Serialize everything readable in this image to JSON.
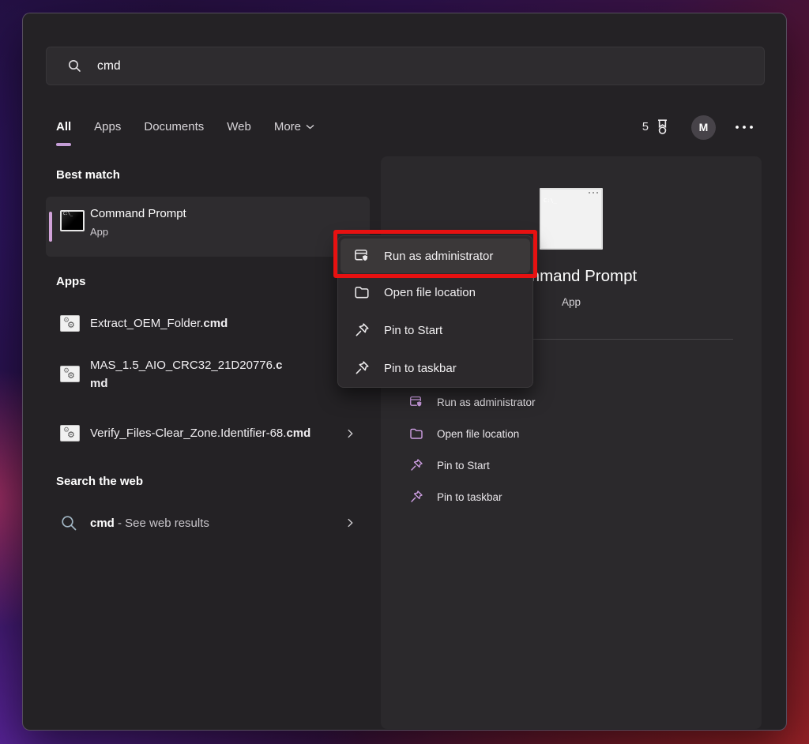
{
  "search": {
    "query": "cmd"
  },
  "tabs": {
    "items": [
      {
        "label": "All"
      },
      {
        "label": "Apps"
      },
      {
        "label": "Documents"
      },
      {
        "label": "Web"
      },
      {
        "label": "More"
      }
    ],
    "active": "All"
  },
  "topbar": {
    "rewards_count": "5",
    "avatar_letter": "M"
  },
  "sections": {
    "best_match": "Best match",
    "apps": "Apps",
    "search_web": "Search the web"
  },
  "best_match": {
    "title": "Command Prompt",
    "subtitle": "App"
  },
  "cmd_icon_label": "C:\\_",
  "apps_list": [
    {
      "name_pre": "Extract_OEM_Folder.",
      "name_bold": "cmd",
      "icon": "batch-file-icon"
    },
    {
      "name_pre": "MAS_1.5_AIO_CRC32_21D20776.",
      "name_bold": "cmd",
      "icon": "batch-file-icon"
    },
    {
      "name_pre": "Verify_Files-Clear_Zone.Identifier-68.",
      "name_bold": "cmd",
      "icon": "batch-file-icon"
    }
  ],
  "web_search": {
    "query": "cmd",
    "suffix": " - See web results"
  },
  "context_menu": {
    "items": [
      {
        "label": "Run as administrator",
        "icon": "run-as-admin-icon",
        "highlighted": true
      },
      {
        "label": "Open file location",
        "icon": "folder-icon"
      },
      {
        "label": "Pin to Start",
        "icon": "pin-icon"
      },
      {
        "label": "Pin to taskbar",
        "icon": "pin-icon"
      }
    ]
  },
  "preview": {
    "title": "Command Prompt",
    "subtitle": "App",
    "actions": [
      {
        "label": "Run as administrator",
        "icon": "run-as-admin-icon"
      },
      {
        "label": "Open file location",
        "icon": "folder-icon"
      },
      {
        "label": "Pin to Start",
        "icon": "pin-icon"
      },
      {
        "label": "Pin to taskbar",
        "icon": "pin-icon"
      }
    ]
  },
  "colors": {
    "accent_underline": "#c49dd6",
    "accent_bar": "#d2a3da",
    "action_icon": "#cf9fe4",
    "annotation_red": "#e71111",
    "window_bg": "#242225",
    "preview_bg": "#2b292c"
  }
}
